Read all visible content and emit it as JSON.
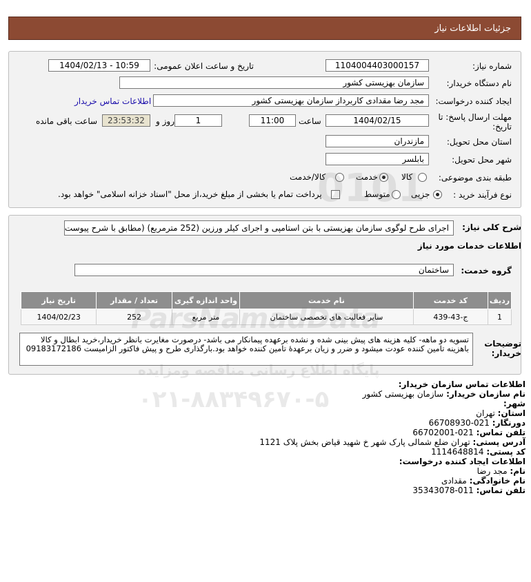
{
  "header": {
    "title": "جزئیات اطلاعات نیاز"
  },
  "form": {
    "need_number_label": "شماره نیاز:",
    "need_number": "1104004403000157",
    "announce_label": "تاریخ و ساعت اعلان عمومی:",
    "announce_value": "1404/02/13 - 10:59",
    "buyer_org_label": "نام دستگاه خریدار:",
    "buyer_org": "سازمان بهزیستی کشور",
    "creator_label": "ایجاد کننده درخواست:",
    "creator": "مجد رضا  مقدادی کاربرداز سازمان بهزیستی کشور",
    "contact_link": "اطلاعات تماس خریدار",
    "deadline_label_1": "مهلت ارسال پاسخ: تا",
    "deadline_label_2": "تاریخ:",
    "deadline_date": "1404/02/15",
    "time_label": "ساعت",
    "deadline_time": "11:00",
    "days_value": "1",
    "days_label": "روز و",
    "remaining_time": "23:53:32",
    "remaining_label": "ساعت باقی مانده",
    "province_label": "استان محل تحویل:",
    "province": "مازندران",
    "city_label": "شهر محل تحویل:",
    "city": "بابلسر",
    "category_label": "طبقه بندی موضوعی:",
    "category_options": [
      "کالا",
      "خدمت",
      "کالا/خدمت"
    ],
    "category_selected": "خدمت",
    "process_label": "نوع فرآیند خرید :",
    "process_options": [
      "جزیی",
      "متوسط"
    ],
    "process_selected": "جزیی",
    "treasury_note": "پرداخت تمام یا بخشی از مبلغ خرید،از محل \"اسناد خزانه اسلامی\" خواهد بود."
  },
  "need": {
    "summary_label": "شرح کلی نیاز:",
    "summary": "اجرای طرح لوگوی سازمان بهزیستی با بتن استامپی و اجرای کیلر ورزین (252 مترمربع) (مطابق با شرح پیوست)",
    "services_title": "اطلاعات خدمات مورد نیاز",
    "service_group_label": "گروه خدمت:",
    "service_group": "ساختمان",
    "table": {
      "headers": [
        "ردیف",
        "کد خدمت",
        "نام خدمت",
        "واحد اندازه گیری",
        "تعداد / مقدار",
        "تاریخ نیاز"
      ],
      "rows": [
        [
          "1",
          "ج-43-439",
          "سایر فعالیت های تخصصی ساختمان",
          "متر مربع",
          "252",
          "1404/02/23"
        ]
      ]
    },
    "buyer_notes_label_1": "توضیحات",
    "buyer_notes_label_2": "خریدار:",
    "buyer_notes": "تسویه دو ماهه- کلیه هزینه های پیش بینی شده و نشده برعهده پیمانکار می باشد- درصورت مغایرت بانظر خریدار،خرید ابطال و کالا باهزینه تامین کننده عودت میشود و ضرر و زیان برعهدۀ تامین کننده خواهد بود.بارگذاری طرح و پیش فاکتور الزامیست 09183172186"
  },
  "contact": {
    "title": "اطلاعات تماس سازمان خریدار:",
    "org_label": "نام سازمان خریدار:",
    "org": "سازمان بهزیستی کشور",
    "city_label": "شهر:",
    "city": "",
    "province_label": "استان:",
    "province": "تهران",
    "fax_label": "دورنگار:",
    "fax": "021-66708930",
    "phone_label": "تلفن تماس:",
    "phone": "021-66702001",
    "address_label": "آدرس پستی:",
    "address": "تهران ضلع شمالی پارک شهر خ شهید قیاض بخش پلاک 1121",
    "postal_label": "کد پستی:",
    "postal": "1114648814",
    "requester_title": "اطلاعات ایجاد کننده درخواست:",
    "name_label": "نام:",
    "name": "مجد رضا",
    "family_label": "نام خانوادگی:",
    "family": "مقدادی",
    "req_phone_label": "تلفن تماس:",
    "req_phone": "011-35343078"
  },
  "watermark": {
    "brand": "ParsNamadData",
    "tagline": "پایگاه اطلاع رسانی مناقصه ومزایده",
    "phone": "۰۲۱-۸۸۳۴۹۶۷۰-۵",
    "digits": "0101"
  }
}
